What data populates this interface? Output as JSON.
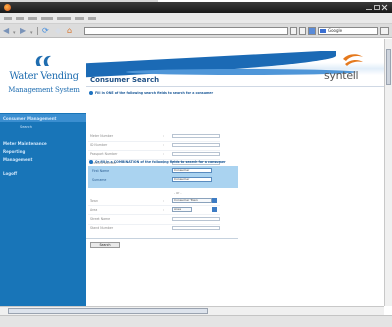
{
  "browser": {
    "search_engine": "Google"
  },
  "app": {
    "name": "Water Vending",
    "subtitle": "Management System",
    "brand": "syntell",
    "page_title": "Consumer Search",
    "colors": {
      "sidebar": "#1875b8",
      "accent": "#1d72c0",
      "highlight_row": "#aad3f0"
    }
  },
  "sidebar": {
    "items": [
      {
        "label": "Consumer Management"
      },
      {
        "label": "Search"
      },
      {
        "label": "Meter Maintenance"
      },
      {
        "label": "Reporting"
      },
      {
        "label": "Management"
      },
      {
        "label": "Logoff"
      }
    ]
  },
  "form": {
    "hint_single": "Fill in ONE of the following search fields to search for a consumer",
    "hint_combination": "Or fill in a COMBINATION of the following fields to search for a consumer",
    "single_fields": [
      {
        "label": "Meter Number"
      },
      {
        "label": "ID Number"
      },
      {
        "label": "Passport Number"
      },
      {
        "label": "Account Number"
      },
      {
        "label": "Card Number"
      }
    ],
    "combo_fields": [
      {
        "label": "First Name",
        "value": "Consumer"
      },
      {
        "label": "Surname",
        "value": "Consumer"
      }
    ],
    "extra_fields": [
      {
        "label": "Town",
        "value": "Consumer Town"
      },
      {
        "label": "Area",
        "value": "Area"
      }
    ],
    "plain_fields": [
      {
        "label": "Street Name"
      },
      {
        "label": "Stand Number"
      }
    ],
    "search_button": "Search"
  }
}
